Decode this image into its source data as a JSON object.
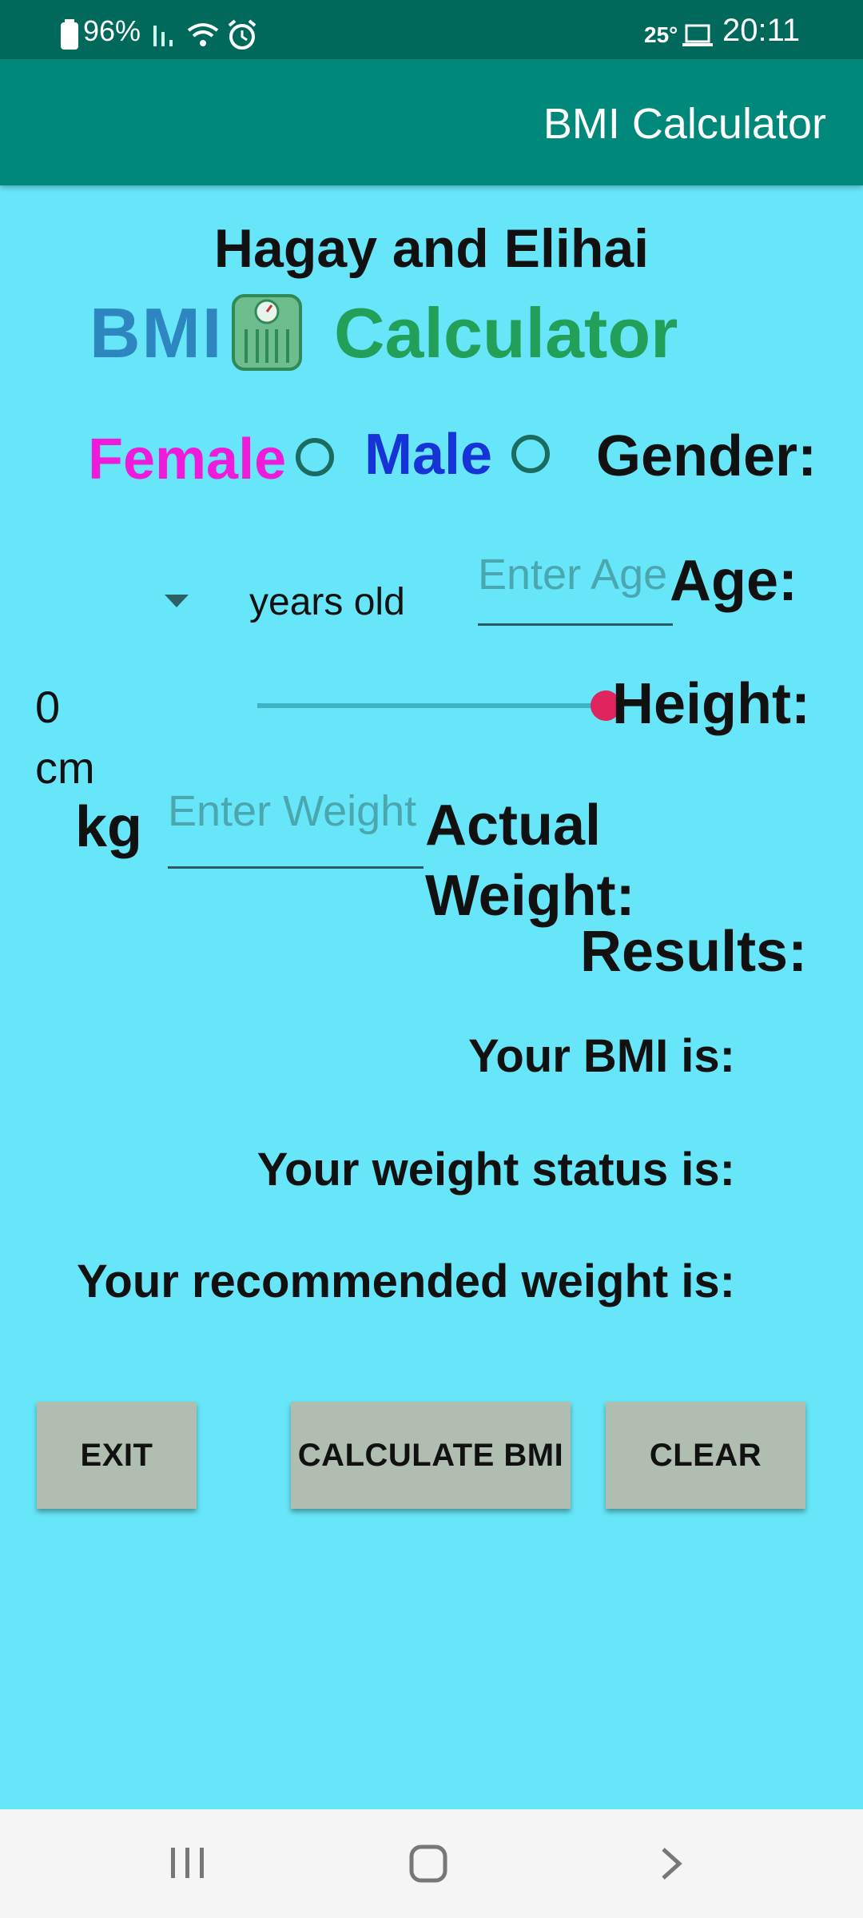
{
  "status_bar": {
    "battery": "96%",
    "temperature": "25°",
    "time": "20:11"
  },
  "app_bar": {
    "title": "BMI Calculator"
  },
  "header": {
    "authors": "Hagay and Elihai",
    "logo_bmi": "BMI",
    "logo_calculator": "Calculator"
  },
  "gender": {
    "label": "Gender:",
    "female": "Female",
    "male": "Male",
    "female_color": "#F01ADB",
    "male_color": "#1533D6"
  },
  "age": {
    "label": "Age:",
    "placeholder": "Enter Age",
    "unit": "years old"
  },
  "height": {
    "label": "Height:",
    "value": "0",
    "unit": "cm",
    "slider_level": 1.0
  },
  "weight": {
    "label_line1": "Actual",
    "label_line2": "Weight:",
    "placeholder": "Enter Weight",
    "unit": "kg"
  },
  "results": {
    "title": "Results:",
    "bmi": "Your BMI is:",
    "status": "Your weight status is:",
    "recommended": "Your recommended weight is:"
  },
  "buttons": {
    "exit": "EXIT",
    "calculate": "CALCULATE BMI",
    "clear": "CLEAR"
  },
  "icons": {
    "battery": "battery-icon",
    "signal": "signal-icon",
    "wifi": "wifi-icon",
    "alarm": "alarm-icon",
    "laptop": "laptop-icon",
    "scale": "scale-icon",
    "dropdown": "chevron-down-icon",
    "recents": "recents-icon",
    "home": "home-icon",
    "back": "back-icon"
  },
  "colors": {
    "background": "#66E6F8",
    "status_bar": "#00695C",
    "app_bar": "#00897B",
    "accent": "#E0245E",
    "logo_blue": "#2E86C1",
    "logo_green": "#22A05A"
  }
}
